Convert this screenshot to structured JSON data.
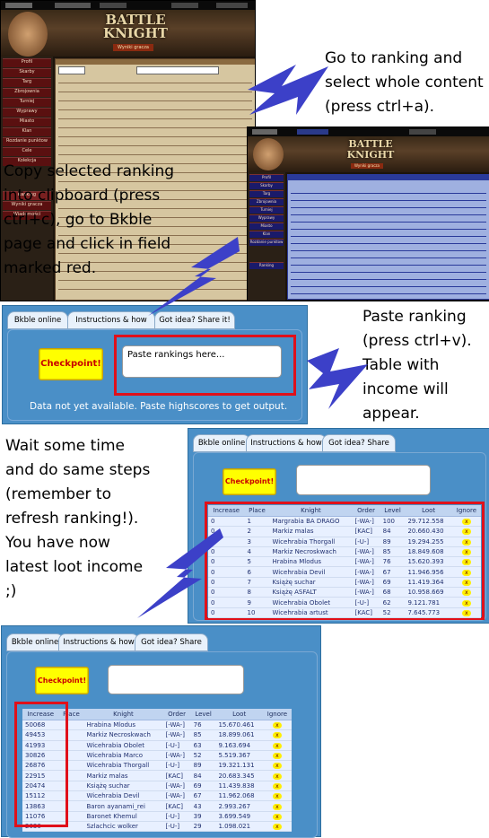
{
  "captions": {
    "step1": "Go to ranking and\nselect whole content\n(press ctrl+a).",
    "step2": "Copy selected ranking\ninto clipboard (press\nctrl+c), go to Bkble\npage and click in field\nmarked red.",
    "step3": "Paste ranking\n(press ctrl+v).\nTable with\nincome will\nappear.",
    "step4": "Wait some time\nand do same steps\n(remember to\nrefresh ranking!).\nYou have now\nlatest loot income\n;)"
  },
  "game": {
    "logo_line1": "BATTLE",
    "logo_line2": "KNIGHT",
    "section_title": "Wyniki gracza",
    "menu_items": [
      "Profil",
      "Skarby",
      "Targ",
      "Zbrojownia",
      "Turniej",
      "Wyprawy",
      "Miasto",
      "Klan",
      "Rozdanie punktow",
      "Cele",
      "Kolekcja",
      "Ranking",
      "Wyniki gracza",
      "Wiadomości"
    ]
  },
  "app": {
    "tabs": [
      "Bkble online",
      "Instructions & how to",
      "Got idea? Share it!"
    ],
    "checkpoint_label": "Checkpoint!",
    "textarea_placeholder": "Paste rankings here...",
    "status_text": "Data not yet available. Paste highscores to get output."
  },
  "table1": {
    "headers": [
      "Increase",
      "Place",
      "Knight",
      "Order",
      "Level",
      "Loot",
      "Ignore"
    ],
    "rows": [
      [
        "0",
        "1",
        "Margrabia BA DRAGO",
        "[-WA-]",
        "100",
        "29.712.558",
        "x"
      ],
      [
        "0",
        "2",
        "Markiz malas",
        "[KAC]",
        "84",
        "20.660.430",
        "x"
      ],
      [
        "0",
        "3",
        "Wicehrabia Thorgall",
        "[-U-]",
        "89",
        "19.294.255",
        "x"
      ],
      [
        "0",
        "4",
        "Markiz Necroskwach",
        "[-WA-]",
        "85",
        "18.849.608",
        "x"
      ],
      [
        "0",
        "5",
        "Hrabina Mlodus",
        "[-WA-]",
        "76",
        "15.620.393",
        "x"
      ],
      [
        "0",
        "6",
        "Wicehrabia Devil",
        "[-WA-]",
        "67",
        "11.946.956",
        "x"
      ],
      [
        "0",
        "7",
        "Książę suchar",
        "[-WA-]",
        "69",
        "11.419.364",
        "x"
      ],
      [
        "0",
        "8",
        "Książę ASFALT",
        "[-WA-]",
        "68",
        "10.958.669",
        "x"
      ],
      [
        "0",
        "9",
        "Wicehrabia Obolet",
        "[-U-]",
        "62",
        "9.121.781",
        "x"
      ],
      [
        "0",
        "10",
        "Wicehrabia artust",
        "[KAC]",
        "52",
        "7.645.773",
        "x"
      ]
    ]
  },
  "table2": {
    "headers": [
      "Increase",
      "Place",
      "Knight",
      "Order",
      "Level",
      "Loot",
      "Ignore"
    ],
    "rows": [
      [
        "50068",
        "",
        "Hrabina Mlodus",
        "[-WA-]",
        "76",
        "15.670.461",
        "x"
      ],
      [
        "49453",
        "",
        "Markiz Necroskwach",
        "[-WA-]",
        "85",
        "18.899.061",
        "x"
      ],
      [
        "41993",
        "",
        "Wicehrabia Obolet",
        "[-U-]",
        "63",
        "9.163.694",
        "x"
      ],
      [
        "30826",
        "",
        "Wicehrabia Marco",
        "[-WA-]",
        "52",
        "5.519.367",
        "x"
      ],
      [
        "26876",
        "",
        "Wicehrabia Thorgall",
        "[-U-]",
        "89",
        "19.321.131",
        "x"
      ],
      [
        "22915",
        "",
        "Markiz malas",
        "[KAC]",
        "84",
        "20.683.345",
        "x"
      ],
      [
        "20474",
        "",
        "Książę suchar",
        "[-WA-]",
        "69",
        "11.439.838",
        "x"
      ],
      [
        "15112",
        "",
        "Wicehrabia Devil",
        "[-WA-]",
        "67",
        "11.962.068",
        "x"
      ],
      [
        "13863",
        "",
        "Baron ayanami_rei",
        "[KAC]",
        "43",
        "2.993.267",
        "x"
      ],
      [
        "11076",
        "",
        "Baronet Khemul",
        "[-U-]",
        "39",
        "3.699.549",
        "x"
      ],
      [
        "2030",
        "",
        "Szlachcic wolker",
        "[-U-]",
        "29",
        "1.098.021",
        "x"
      ]
    ]
  },
  "colors": {
    "app_bg": "#4a8fc7",
    "highlight": "#e0101a",
    "arrow": "#3c40c8",
    "checkpoint": "#ffff00"
  }
}
